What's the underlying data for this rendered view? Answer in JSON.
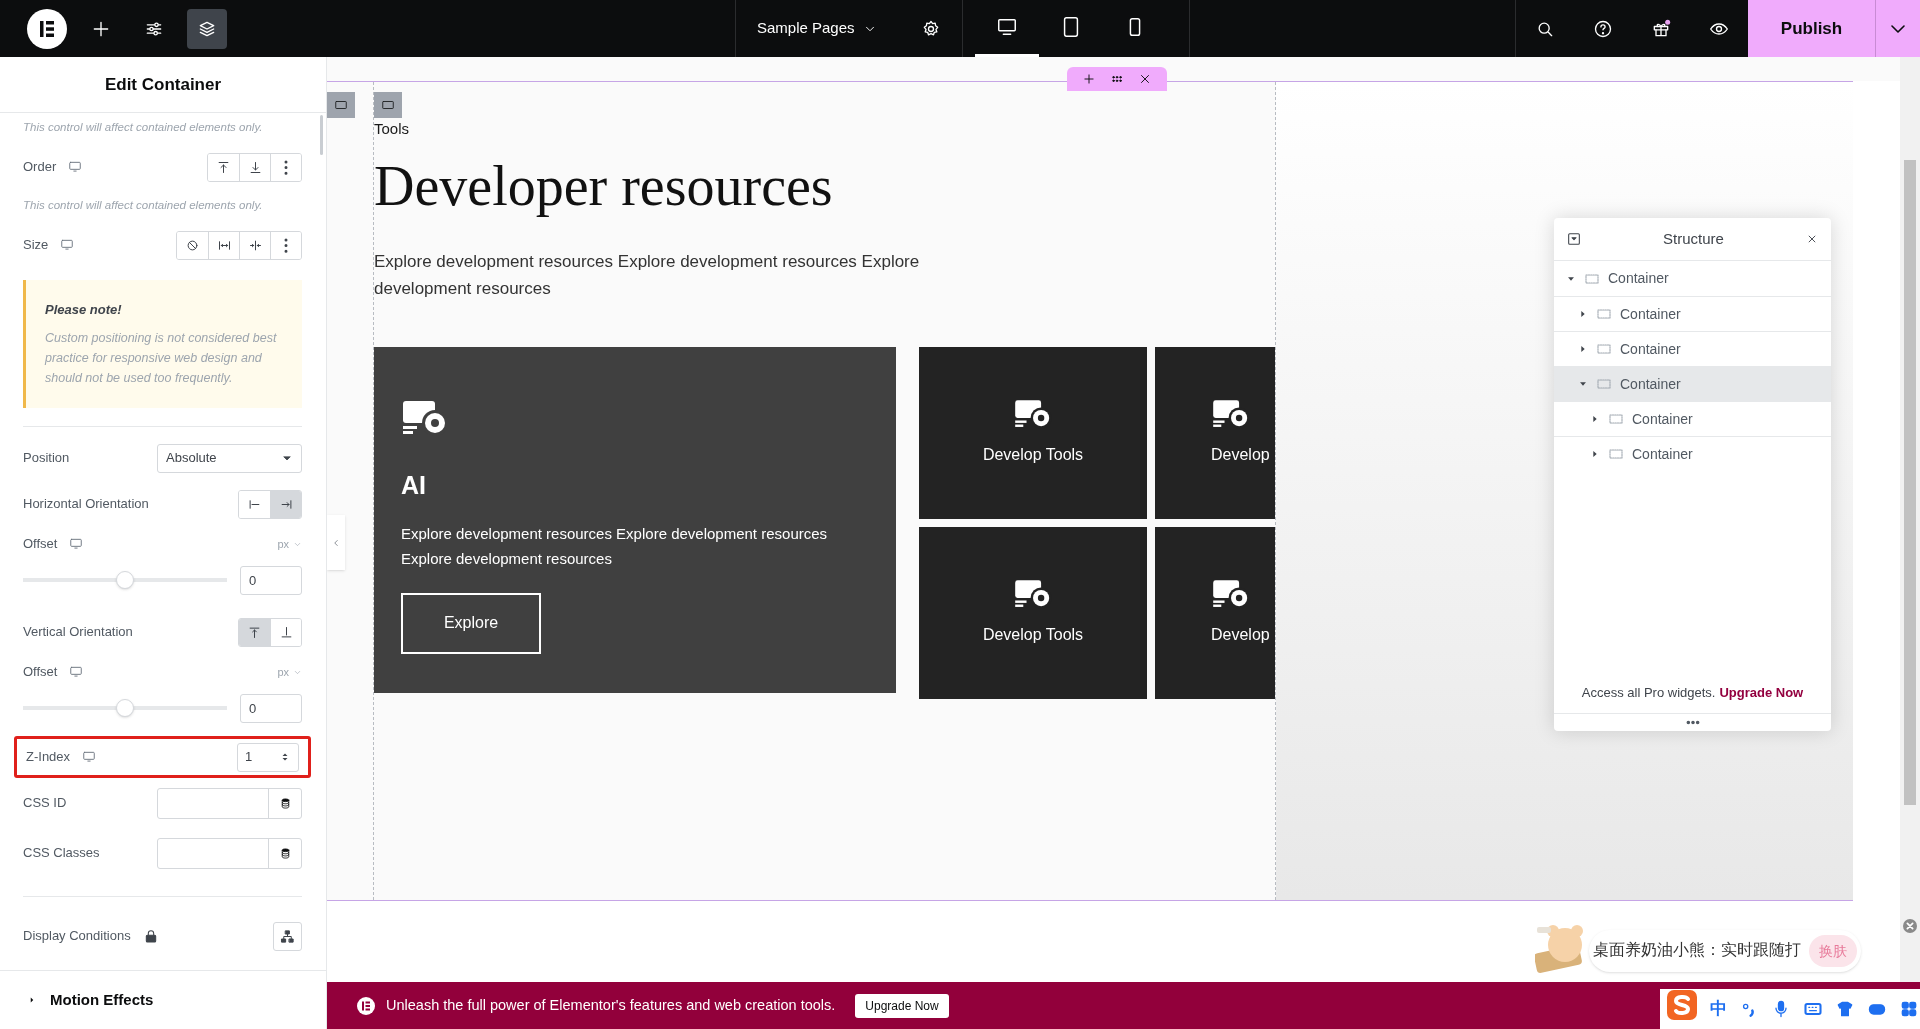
{
  "top_bar": {
    "tools": [
      {
        "kind": "add",
        "selected": false
      },
      {
        "kind": "settings",
        "selected": false
      },
      {
        "kind": "layers",
        "selected": true
      }
    ],
    "page_selector": "Sample Pages",
    "devices": [
      {
        "kind": "desktop",
        "selected": true
      },
      {
        "kind": "tablet",
        "selected": false
      },
      {
        "kind": "mobile",
        "selected": false
      }
    ],
    "publish": "Publish"
  },
  "panel": {
    "title": "Edit Container",
    "controls": [
      {
        "kind": "hint",
        "text": "This control will affect contained elements only."
      },
      {
        "kind": "buttons",
        "label": "Order",
        "responsive": true,
        "buttons": [
          {
            "kind": "start"
          },
          {
            "kind": "end"
          },
          {
            "kind": "more"
          }
        ]
      },
      {
        "kind": "hint",
        "text": "This control will affect contained elements only."
      },
      {
        "kind": "buttons",
        "label": "Size",
        "responsive": true,
        "buttons": [
          {
            "kind": "none"
          },
          {
            "kind": "grow"
          },
          {
            "kind": "shrink"
          },
          {
            "kind": "more"
          }
        ]
      },
      {
        "kind": "note",
        "title": "Please note!",
        "text": "Custom positioning is not considered best practice for responsive web design and should not be used too frequently."
      },
      {
        "kind": "divider"
      },
      {
        "kind": "select",
        "label": "Position",
        "responsive": false,
        "value": "Absolute"
      },
      {
        "kind": "toggle",
        "label": "Horizontal Orientation",
        "options": [
          {
            "kind": "left",
            "selected": false
          },
          {
            "kind": "right",
            "selected": true
          }
        ]
      },
      {
        "kind": "slider",
        "label": "Offset",
        "responsive": true,
        "unit": "px",
        "level": 0.5,
        "value": "0"
      },
      {
        "kind": "toggle",
        "label": "Vertical Orientation",
        "options": [
          {
            "kind": "top",
            "selected": true
          },
          {
            "kind": "bottom",
            "selected": false
          }
        ]
      },
      {
        "kind": "slider",
        "label": "Offset",
        "responsive": true,
        "unit": "px",
        "level": 0.5,
        "value": "0"
      },
      {
        "kind": "number",
        "label": "Z-Index",
        "responsive": true,
        "value": "1",
        "highlighted": true
      },
      {
        "kind": "text",
        "label": "CSS ID"
      },
      {
        "kind": "text",
        "label": "CSS Classes"
      },
      {
        "kind": "divider"
      },
      {
        "kind": "conditions",
        "label": "Display Conditions",
        "locked": true
      }
    ],
    "section": {
      "label": "Motion Effects",
      "expanded": false
    }
  },
  "canvas": {
    "tag": "Tools",
    "heading": "Developer resources",
    "intro": "Explore development resources Explore development resources Explore development resources",
    "feature": {
      "title": "AI",
      "text": "Explore development resources Explore development resources Explore development resources",
      "button": "Explore"
    },
    "tiles": [
      {
        "label": "Develop Tools"
      },
      {
        "label": "Develop"
      },
      {
        "label": "Develop Tools"
      },
      {
        "label": "Develop"
      }
    ]
  },
  "structure": {
    "title": "Structure",
    "tree": [
      {
        "label": "Container",
        "expanded": true,
        "selected": false,
        "children": [
          {
            "label": "Container",
            "expanded": false,
            "selected": false
          },
          {
            "label": "Container",
            "expanded": false,
            "selected": false
          },
          {
            "label": "Container",
            "expanded": true,
            "selected": true,
            "children": [
              {
                "label": "Container",
                "expanded": false,
                "selected": false
              },
              {
                "label": "Container",
                "expanded": false,
                "selected": false
              }
            ]
          }
        ]
      }
    ],
    "footer": "Access all Pro widgets.",
    "footer_link": "Upgrade Now"
  },
  "banner": {
    "text": "Unleash the full power of Elementor's features and web creation tools.",
    "button": "Upgrade Now"
  },
  "ime_popup": {
    "text": "桌面养奶油小熊：实时跟随打",
    "button": "换肤"
  },
  "ime_bar": {
    "mode": "中"
  }
}
